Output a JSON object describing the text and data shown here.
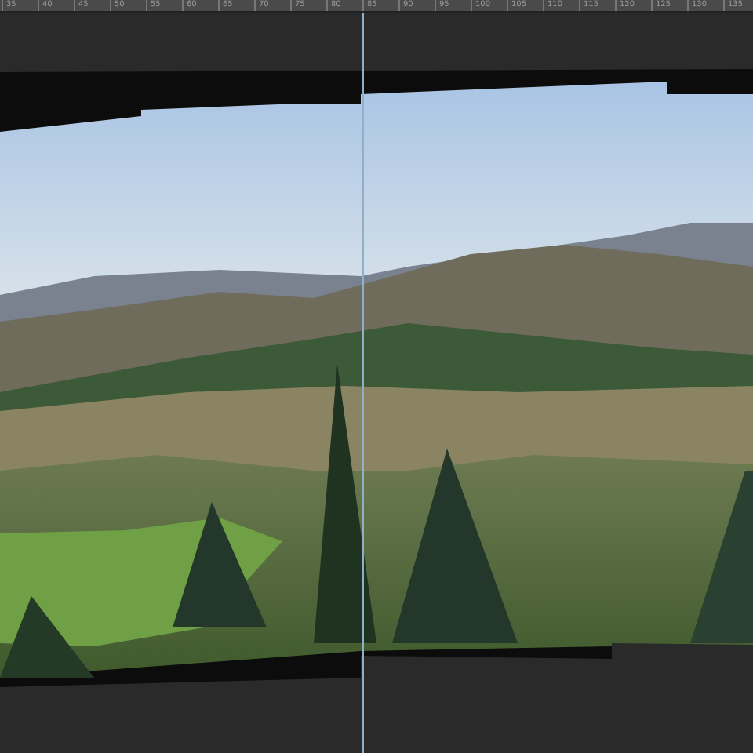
{
  "ruler": {
    "labels": [
      "35",
      "40",
      "45",
      "50",
      "55",
      "60",
      "65",
      "70",
      "75",
      "80",
      "85",
      "90",
      "95",
      "100",
      "105",
      "110",
      "115",
      "120",
      "125",
      "130",
      "135"
    ]
  },
  "canvas": {
    "guide_line": true
  }
}
